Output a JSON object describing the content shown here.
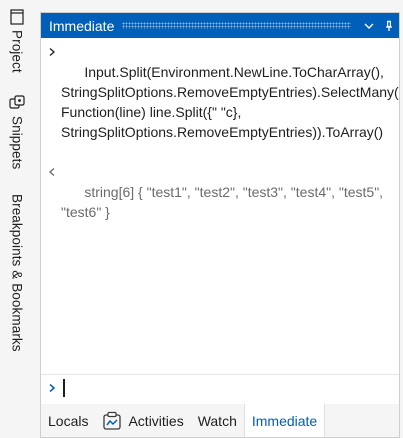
{
  "side_tabs": [
    {
      "label": "Project",
      "icon": "project-page-icon"
    },
    {
      "label": "Snippets",
      "icon": "snippets-icon"
    },
    {
      "label": "Breakpoints & Bookmarks",
      "icon": ""
    }
  ],
  "window": {
    "title": "Immediate",
    "buttons": [
      "chevron-down-icon",
      "pin-icon"
    ]
  },
  "console": {
    "input_text": "Input.Split(Environment.NewLine.ToCharArray(), StringSplitOptions.RemoveEmptyEntries).SelectMany(Function(line) line.Split({\" \"c}, StringSplitOptions.RemoveEmptyEntries)).ToArray()",
    "result_text": "string[6] { \"test1\", \"test2\", \"test3\", \"test4\", \"test5\", \"test6\" }",
    "command_value": ""
  },
  "bottom_tabs": [
    {
      "label": "Locals",
      "active": false
    },
    {
      "label": "Activities",
      "active": false
    },
    {
      "label": "Watch",
      "active": false
    },
    {
      "label": "Immediate",
      "active": true
    }
  ],
  "colors": {
    "accent": "#005fb8",
    "titlebar_text": "#ffffff",
    "result_text": "#6b6b6b"
  }
}
